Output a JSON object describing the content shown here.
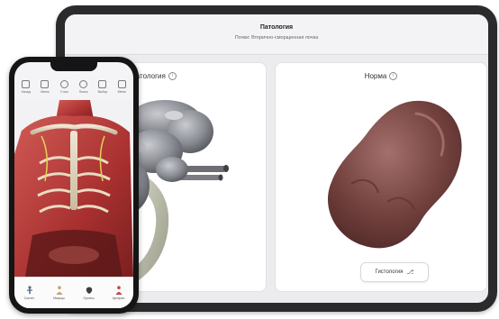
{
  "tablet": {
    "header": {
      "title": "Патология",
      "subtitle": "Почки: Вторично-сморщенная почка"
    },
    "left_panel": {
      "title": "Патология",
      "info_icon": "info-icon"
    },
    "right_panel": {
      "title": "Норма",
      "info_icon": "info-icon",
      "histology_button": {
        "label": "Гистология",
        "icon": "microscope-icon"
      }
    }
  },
  "phone": {
    "toolbar": [
      {
        "label": "Назад",
        "icon": "back-icon"
      },
      {
        "label": "Меню",
        "icon": "menu-icon"
      },
      {
        "label": "Слои",
        "icon": "layers-icon"
      },
      {
        "label": "Поиск",
        "icon": "search-icon"
      },
      {
        "label": "Выбор",
        "icon": "select-icon"
      },
      {
        "label": "Меню",
        "icon": "more-icon"
      }
    ],
    "bottom_nav": [
      {
        "label": "Скелет",
        "icon": "skeleton-icon"
      },
      {
        "label": "Мышцы",
        "icon": "muscles-icon"
      },
      {
        "label": "Органы",
        "icon": "organs-icon"
      },
      {
        "label": "Артерии",
        "icon": "arteries-icon"
      }
    ]
  },
  "colors": {
    "tablet_frame": "#2b2b2d",
    "phone_frame": "#151515",
    "kidney_normal": "#7a4a48",
    "kidney_pathology": "#8d8f96",
    "muscle": "#b83a38"
  }
}
